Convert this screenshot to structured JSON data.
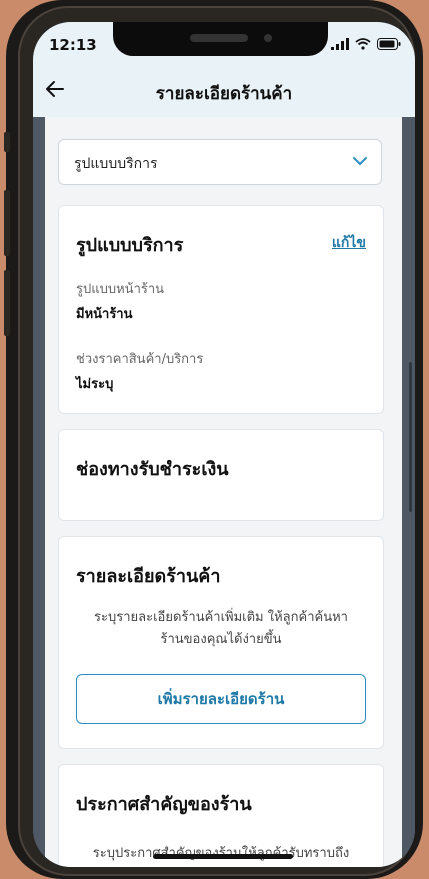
{
  "status": {
    "time": "12:13"
  },
  "nav": {
    "title": "รายละเอียดร้านค้า"
  },
  "select": {
    "value": "รูปแบบบริการ"
  },
  "service_card": {
    "title": "รูปแบบบริการ",
    "edit_label": "แก้ไข",
    "storefront_label": "รูปแบบหน้าร้าน",
    "storefront_value": "มีหน้าร้าน",
    "price_label": "ช่วงราคาสินค้า/บริการ",
    "price_value": "ไม่ระบุ"
  },
  "payment_card": {
    "title": "ช่องทางรับชำระเงิน"
  },
  "details_card": {
    "title": "รายละเอียดร้านค้า",
    "desc_line1": "ระบุรายละเอียดร้านค้าเพิ่มเติม ให้ลูกค้าค้นหา",
    "desc_line2": "ร้านของคุณได้ง่ายขึ้น",
    "button_label": "เพิ่มรายละเอียดร้าน"
  },
  "announce_card": {
    "title": "ประกาศสำคัญของร้าน",
    "desc_line1": "ระบุประกาศสำคัญของร้านให้ลูกค้ารับทราบถึง"
  },
  "colors": {
    "accent": "#1f7aa8",
    "header_bg": "#e8f2f7",
    "content_bg": "#f2f4f6"
  },
  "icons": {
    "back": "arrow-left-icon",
    "chevron": "chevron-down-icon"
  }
}
